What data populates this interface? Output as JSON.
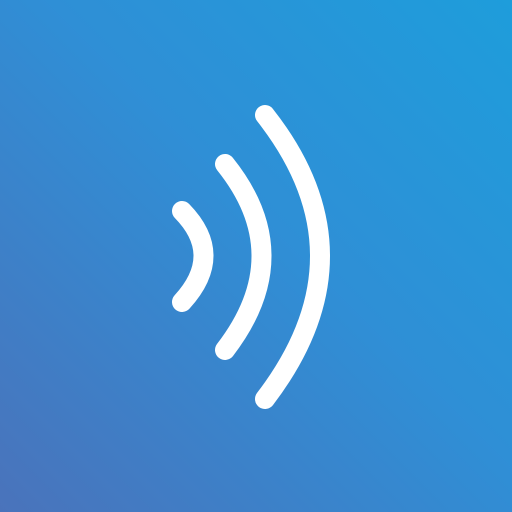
{
  "icon": {
    "name": "contactless-signal-icon",
    "wave_count": 3,
    "colors": {
      "gradient_top_right": "#1e9ddb",
      "gradient_bottom_left": "#4a73bb",
      "waves": "#ffffff"
    }
  }
}
